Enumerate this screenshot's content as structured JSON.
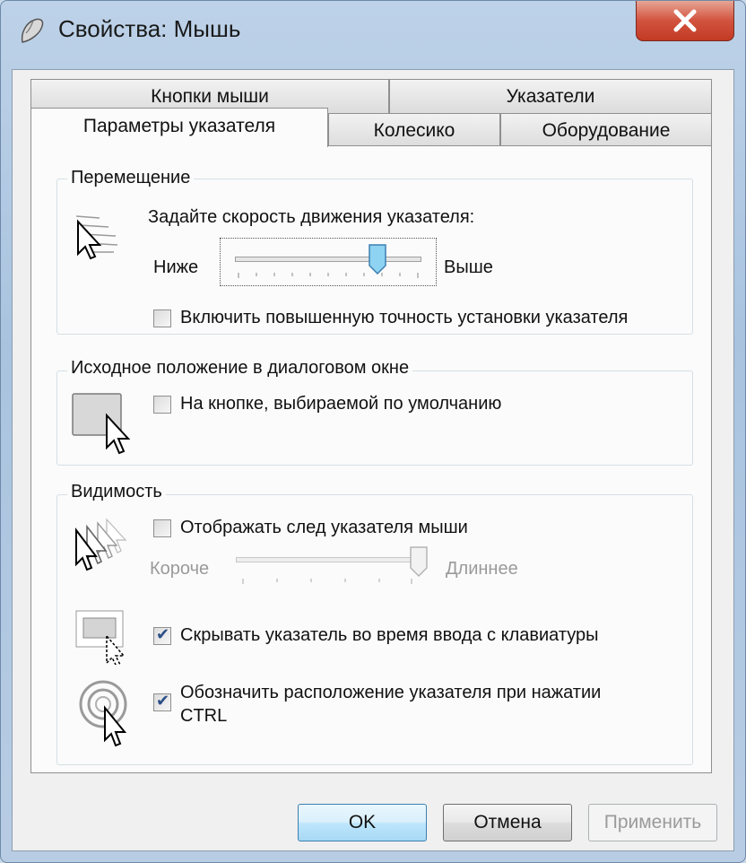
{
  "window": {
    "title": "Свойства: Мышь"
  },
  "tabs": {
    "row1": [
      "Кнопки мыши",
      "Указатели"
    ],
    "row2": [
      "Параметры указателя",
      "Колесико",
      "Оборудование"
    ]
  },
  "motion": {
    "legend": "Перемещение",
    "speed_label": "Задайте скорость движения указателя:",
    "slow": "Ниже",
    "fast": "Выше",
    "speed_value": 0.77,
    "precision_label": "Включить повышенную точность установки указателя",
    "precision_checked": false
  },
  "snap": {
    "legend": "Исходное положение в диалоговом окне",
    "snap_label": "На кнопке, выбираемой по умолчанию",
    "snap_checked": false
  },
  "visibility": {
    "legend": "Видимость",
    "trails_label": "Отображать след указателя мыши",
    "trails_checked": false,
    "short": "Короче",
    "long": "Длиннее",
    "trail_value": 1.0,
    "hide_label": "Скрывать указатель во время ввода с клавиатуры",
    "hide_checked": true,
    "ctrl_label_1": "Обозначить расположение указателя при нажатии",
    "ctrl_label_2": "CTRL",
    "ctrl_checked": true
  },
  "buttons": {
    "ok": "OK",
    "cancel": "Отмена",
    "apply": "Применить"
  },
  "colors": {
    "accent": "#3c7fb1",
    "close": "#c23a24",
    "thumb": "#6fc3e8"
  }
}
